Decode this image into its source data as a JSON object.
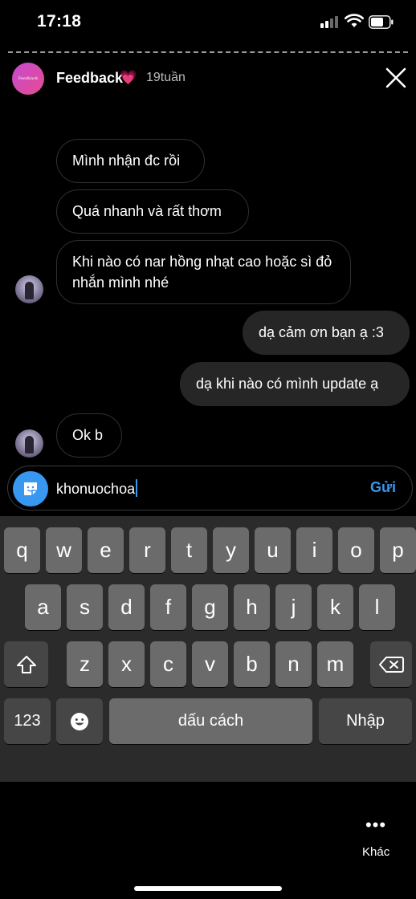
{
  "status": {
    "time": "17:18"
  },
  "header": {
    "avatar_text": "Feedback",
    "name": "Feedback",
    "heart": "💗",
    "time_ago": "19tuần",
    "close_icon": "close-icon"
  },
  "messages": [
    {
      "text": "Mình nhận đc rồi",
      "direction": "in"
    },
    {
      "text": "Quá nhanh và rất thơm",
      "direction": "in"
    },
    {
      "text": "Khi nào có nar hồng nhạt cao hoặc sì đỏ nhắn mình nhé",
      "direction": "in"
    },
    {
      "text": "dạ cảm ơn bạn ạ :3",
      "direction": "out"
    },
    {
      "text": "dạ khi nào có mình update ạ",
      "direction": "out"
    },
    {
      "text": "Ok b",
      "direction": "in"
    }
  ],
  "composer": {
    "value": "khonuochoa",
    "send_label": "Gửi",
    "sticker_icon": "sticker-icon"
  },
  "keyboard": {
    "row1": [
      "q",
      "w",
      "e",
      "r",
      "t",
      "y",
      "u",
      "i",
      "o",
      "p"
    ],
    "row2": [
      "a",
      "s",
      "d",
      "f",
      "g",
      "h",
      "j",
      "k",
      "l"
    ],
    "row3": [
      "z",
      "x",
      "c",
      "v",
      "b",
      "n",
      "m"
    ],
    "numbers_label": "123",
    "space_label": "dấu cách",
    "return_label": "Nhập",
    "shift_icon": "shift-icon",
    "backspace_icon": "backspace-icon",
    "emoji_icon": "emoji-icon"
  },
  "footer": {
    "more_label": "Khác",
    "more_icon": "more-dots-icon"
  },
  "colors": {
    "accent": "#3897f0",
    "bubble_out": "#262626",
    "keyboard_bg": "#2b2b2b",
    "key_bg": "#6b6b6b"
  }
}
